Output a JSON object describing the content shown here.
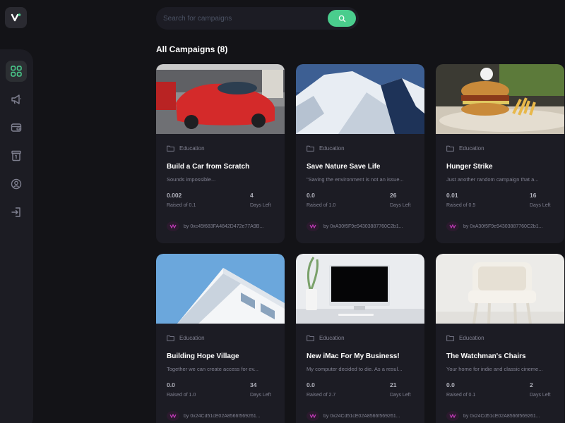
{
  "search": {
    "placeholder": "Search for campaigns"
  },
  "section": {
    "title": "All Campaigns (8)"
  },
  "sidebar": {
    "items": [
      {
        "icon": "dashboard-icon",
        "active": true
      },
      {
        "icon": "megaphone-icon",
        "active": false
      },
      {
        "icon": "payment-icon",
        "active": false
      },
      {
        "icon": "withdraw-icon",
        "active": false
      },
      {
        "icon": "profile-icon",
        "active": false
      },
      {
        "icon": "logout-icon",
        "active": false
      }
    ]
  },
  "colors": {
    "accent": "#4acd8d",
    "bg": "#131317",
    "card": "#1c1c24"
  },
  "campaigns": [
    {
      "category": "Education",
      "title": "Build a Car from Scratch",
      "description": "Sounds impossible...",
      "raised": "0.002",
      "raised_label": "Raised of 0.1",
      "days": "4",
      "days_label": "Days Left",
      "owner": "by 0xc45f683FA4842D472e77A9B..."
    },
    {
      "category": "Education",
      "title": "Save Nature Save Life",
      "description": "\"Saving the environment is not an issue...",
      "raised": "0.0",
      "raised_label": "Raised of 1.0",
      "days": "26",
      "days_label": "Days Left",
      "owner": "by 0xA30f5F9e94303887760C2b1..."
    },
    {
      "category": "Education",
      "title": "Hunger Strike",
      "description": "Just another random campaign that a...",
      "raised": "0.01",
      "raised_label": "Raised of 0.5",
      "days": "16",
      "days_label": "Days Left",
      "owner": "by 0xA30f5F9e94303887760C2b1..."
    },
    {
      "category": "Education",
      "title": "Building Hope Village",
      "description": "Together we can create access for ev...",
      "raised": "0.0",
      "raised_label": "Raised of 1.0",
      "days": "34",
      "days_label": "Days Left",
      "owner": "by 0x24Cd51cE02A8566f569261..."
    },
    {
      "category": "Education",
      "title": "New iMac For My Business!",
      "description": "My computer decided to die. As a resul...",
      "raised": "0.0",
      "raised_label": "Raised of 2.7",
      "days": "21",
      "days_label": "Days Left",
      "owner": "by 0x24Cd51cE02A8566f569261..."
    },
    {
      "category": "Education",
      "title": "The Watchman's Chairs",
      "description": "Your home for indie and classic cineme...",
      "raised": "0.0",
      "raised_label": "Raised of 0.1",
      "days": "2",
      "days_label": "Days Left",
      "owner": "by 0x24Cd51cE02A8566f569261..."
    }
  ]
}
